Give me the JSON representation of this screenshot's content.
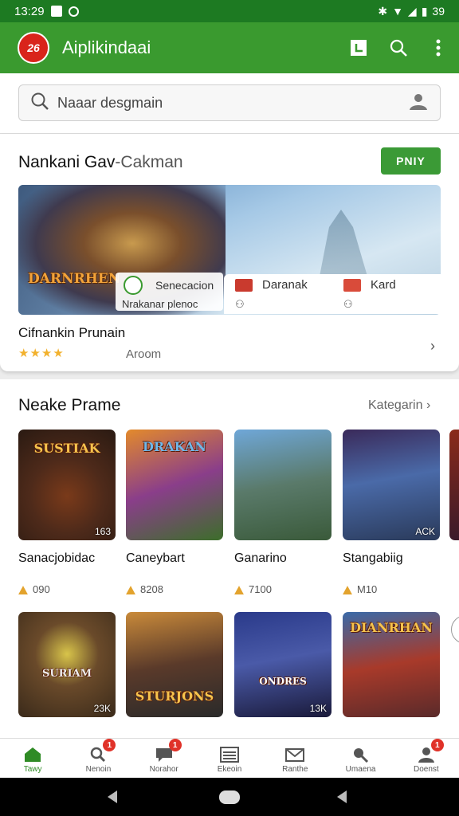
{
  "status_bar": {
    "time": "13:29",
    "battery": "39"
  },
  "app_bar": {
    "logo_text": "26",
    "title": "Aiplikindaai"
  },
  "search": {
    "placeholder": "Naaar desgmain"
  },
  "featured": {
    "title_main": "Nankani Gav",
    "title_rest": "-Cakman",
    "view_button": "PNIY",
    "banner_logo": "DARNRHEN",
    "chip_text_1": "Senecacion",
    "chip_text_2": "Nrakanar plenoc",
    "info_items": [
      "Daranak",
      "Kard"
    ],
    "game_title": "Cifnankin Prunain",
    "stars": "★★★★",
    "rating_text": "Aroom"
  },
  "new_section": {
    "title": "Neake Prame",
    "category_link": "Kategarin ›",
    "row1": [
      {
        "name": "Sanacjobidac",
        "meta": "090",
        "badge": "163",
        "logo": "SUSTIAK"
      },
      {
        "name": "Caneybart",
        "meta": "8208",
        "badge": "",
        "logo": "DRAKAN"
      },
      {
        "name": "Ganarino",
        "meta": "7100",
        "badge": "",
        "logo": ""
      },
      {
        "name": "Stangabiig",
        "meta": "M10",
        "badge": "ACK",
        "logo": ""
      }
    ],
    "row2": [
      {
        "badge": "23K",
        "logo": "SURIAM"
      },
      {
        "badge": "",
        "logo": "STURJONS"
      },
      {
        "badge": "13K",
        "logo": "ONDRES"
      },
      {
        "badge": "",
        "logo": "DIANRHAN"
      }
    ]
  },
  "bottom_nav": [
    {
      "label": "Tawy",
      "badge": ""
    },
    {
      "label": "Nenoin",
      "badge": "1"
    },
    {
      "label": "Norahor",
      "badge": "1"
    },
    {
      "label": "Ekeoin",
      "badge": ""
    },
    {
      "label": "Ranthe",
      "badge": ""
    },
    {
      "label": "Umaena",
      "badge": ""
    },
    {
      "label": "Doenst",
      "badge": "1"
    }
  ],
  "colors": {
    "status_bar": "#1d7a22",
    "app_bar": "#3a9a2f",
    "accent": "#3b9a36",
    "badge": "#e03229"
  }
}
